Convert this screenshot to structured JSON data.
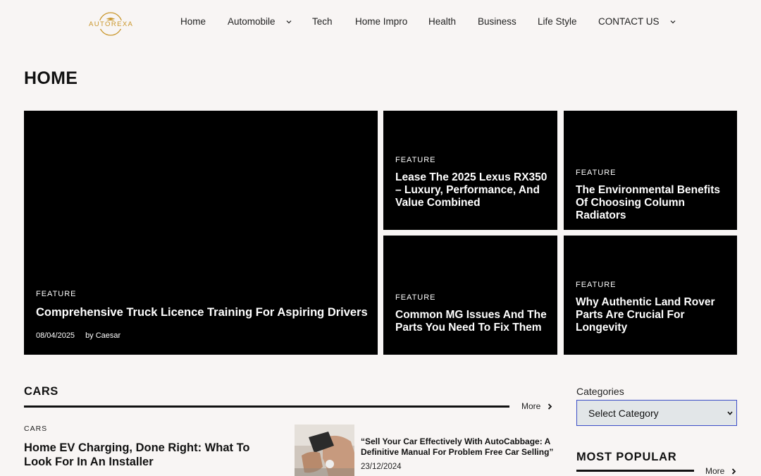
{
  "brand": {
    "name": "AUTOREXA",
    "accent": "#c9962a"
  },
  "nav": {
    "items": [
      {
        "label": "Home",
        "has_dropdown": false
      },
      {
        "label": "Automobile",
        "has_dropdown": true
      },
      {
        "label": "Tech",
        "has_dropdown": false
      },
      {
        "label": "Home Impro",
        "has_dropdown": false
      },
      {
        "label": "Health",
        "has_dropdown": false
      },
      {
        "label": "Business",
        "has_dropdown": false
      },
      {
        "label": "Life Style",
        "has_dropdown": false
      },
      {
        "label": "CONTACT US",
        "has_dropdown": true
      }
    ]
  },
  "page": {
    "title": "HOME"
  },
  "features": [
    {
      "category": "FEATURE",
      "title": "Comprehensive Truck Licence Training For Aspiring Drivers",
      "date": "08/04/2025",
      "author": "by Caesar"
    },
    {
      "category": "FEATURE",
      "title": "Lease The 2025 Lexus RX350 – Luxury, Performance, And Value Combined"
    },
    {
      "category": "FEATURE",
      "title": "The Environmental Benefits Of Choosing Column Radiators"
    },
    {
      "category": "FEATURE",
      "title": "Common MG Issues And The Parts You Need To Fix Them"
    },
    {
      "category": "FEATURE",
      "title": "Why Authentic Land Rover Parts Are Crucial For Longevity"
    }
  ],
  "cars": {
    "section_title": "CARS",
    "more_label": "More",
    "main_post": {
      "category": "CARS",
      "title": "Home EV Charging, Done Right: What To Look For In An Installer"
    },
    "side_post": {
      "title": "“Sell Your Car Effectively With AutoCabbage: A Definitive Manual For Problem Free Car Selling”",
      "date": "23/12/2024"
    }
  },
  "sidebar": {
    "categories_label": "Categories",
    "select_value": "Select Category",
    "most_popular_title": "MOST POPULAR",
    "more_label": "More"
  }
}
